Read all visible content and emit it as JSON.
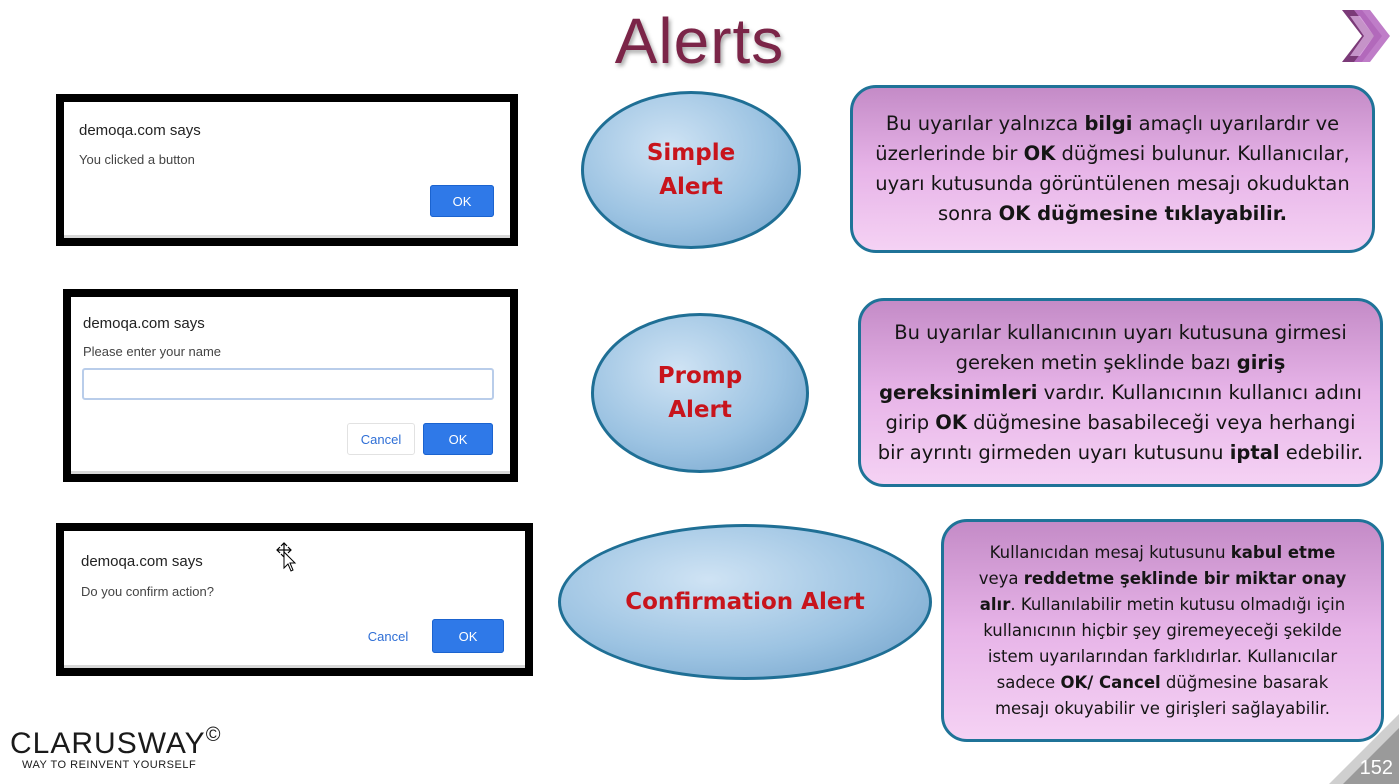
{
  "slide": {
    "title": "Alerts",
    "page_number": "152"
  },
  "brand": {
    "name": "CLARUSWAY",
    "copyright": "©",
    "tagline": "WAY TO REINVENT YOURSELF"
  },
  "simple_dialog": {
    "title": "demoqa.com says",
    "message": "You clicked a button",
    "ok_label": "OK"
  },
  "prompt_dialog": {
    "title": "demoqa.com says",
    "message": "Please enter your name",
    "input_value": "",
    "cancel_label": "Cancel",
    "ok_label": "OK"
  },
  "confirm_dialog": {
    "title": "demoqa.com says",
    "message": "Do you confirm action?",
    "cancel_label": "Cancel",
    "ok_label": "OK"
  },
  "labels": {
    "simple": "Simple\nAlert",
    "prompt": "Promp\nAlert",
    "confirm": "Confirmation Alert"
  },
  "descriptions": {
    "simple": [
      {
        "t": "Bu uyarılar yalnızca "
      },
      {
        "t": "bilgi",
        "b": true
      },
      {
        "t": " amaçlı uyarılardır ve üzerlerinde bir "
      },
      {
        "t": "OK",
        "b": true
      },
      {
        "t": " düğmesi bulunur. Kullanıcılar, uyarı kutusunda görüntülenen mesajı okuduktan sonra "
      },
      {
        "t": "OK düğmesine tıklayabilir.",
        "b": true
      }
    ],
    "prompt": [
      {
        "t": "Bu uyarılar kullanıcının uyarı kutusuna girmesi gereken metin şeklinde bazı "
      },
      {
        "t": "giriş gereksinimleri",
        "b": true
      },
      {
        "t": " vardır. Kullanıcının kullanıcı adını girip "
      },
      {
        "t": "OK",
        "b": true
      },
      {
        "t": " düğmesine basabileceği veya herhangi bir ayrıntı girmeden uyarı kutusunu "
      },
      {
        "t": "iptal",
        "b": true
      },
      {
        "t": " edebilir."
      }
    ],
    "confirm": [
      {
        "t": "Kullanıcıdan mesaj kutusunu "
      },
      {
        "t": "kabul etme",
        "b": true
      },
      {
        "t": " veya "
      },
      {
        "t": "reddetme şeklinde bir miktar onay alır",
        "b": true
      },
      {
        "t": ". Kullanılabilir metin kutusu olmadığı için kullanıcının hiçbir şey giremeyeceği şekilde istem uyarılarından farklıdırlar. Kullanıcılar sadece "
      },
      {
        "t": "OK/ Cancel",
        "b": true
      },
      {
        "t": " düğmesine basarak mesajı okuyabilir ve girişleri sağlayabilir."
      }
    ]
  },
  "colors": {
    "title": "#7b2548",
    "label_red": "#c8141c",
    "ok_blue": "#2f79e8",
    "border_teal": "#1f7398"
  }
}
